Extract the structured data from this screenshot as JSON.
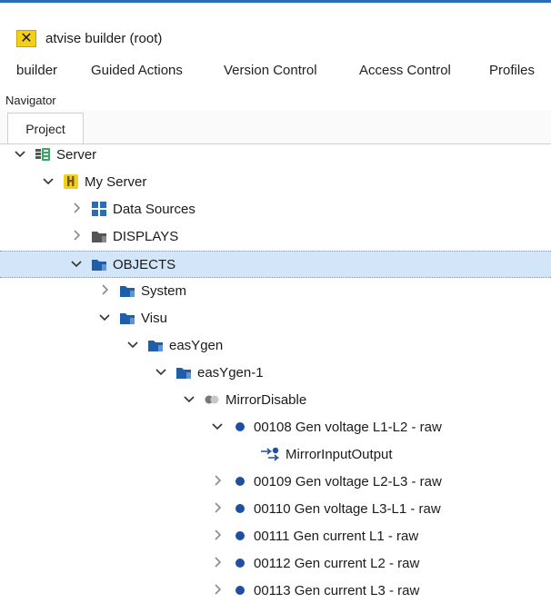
{
  "app": {
    "logo_glyph": "✕",
    "title": "atvise builder (root)"
  },
  "menu": [
    "builder",
    "Guided Actions",
    "Version Control",
    "Access Control",
    "Profiles"
  ],
  "panel": {
    "title": "Navigator",
    "tab": "Project"
  },
  "tree": [
    {
      "label": "Server",
      "expander": "expanded",
      "icon": "server-icon"
    },
    {
      "label": "My Server",
      "expander": "expanded",
      "icon": "server-instance-icon"
    },
    {
      "label": "Data Sources",
      "expander": "collapsed",
      "icon": "data-sources-icon"
    },
    {
      "label": "DISPLAYS",
      "expander": "collapsed",
      "icon": "displays-folder-icon"
    },
    {
      "label": "OBJECTS",
      "expander": "expanded",
      "icon": "objects-folder-icon",
      "selected": true
    },
    {
      "label": "System",
      "expander": "collapsed",
      "icon": "folder-icon"
    },
    {
      "label": "Visu",
      "expander": "expanded",
      "icon": "folder-icon"
    },
    {
      "label": "easYgen",
      "expander": "expanded",
      "icon": "folder-icon"
    },
    {
      "label": "easYgen-1",
      "expander": "expanded",
      "icon": "folder-icon"
    },
    {
      "label": "MirrorDisable",
      "expander": "expanded",
      "icon": "variable-gray-icon"
    },
    {
      "label": "00108 Gen voltage L1-L2 - raw",
      "expander": "expanded",
      "icon": "variable-icon"
    },
    {
      "label": "MirrorInputOutput",
      "expander": "none",
      "icon": "mirror-reference-icon"
    },
    {
      "label": "00109 Gen voltage L2-L3 - raw",
      "expander": "collapsed",
      "icon": "variable-icon"
    },
    {
      "label": "00110 Gen voltage L3-L1 - raw",
      "expander": "collapsed",
      "icon": "variable-icon"
    },
    {
      "label": "00111 Gen current L1 - raw",
      "expander": "collapsed",
      "icon": "variable-icon"
    },
    {
      "label": "00112 Gen current L2 - raw",
      "expander": "collapsed",
      "icon": "variable-icon"
    },
    {
      "label": "00113 Gen current L3 - raw",
      "expander": "collapsed",
      "icon": "variable-icon"
    }
  ],
  "colors": {
    "accent": "#2b6cb8",
    "selection": "#d3e5f8",
    "folder": "#1f5fa8",
    "logo": "#f2cf1a"
  }
}
